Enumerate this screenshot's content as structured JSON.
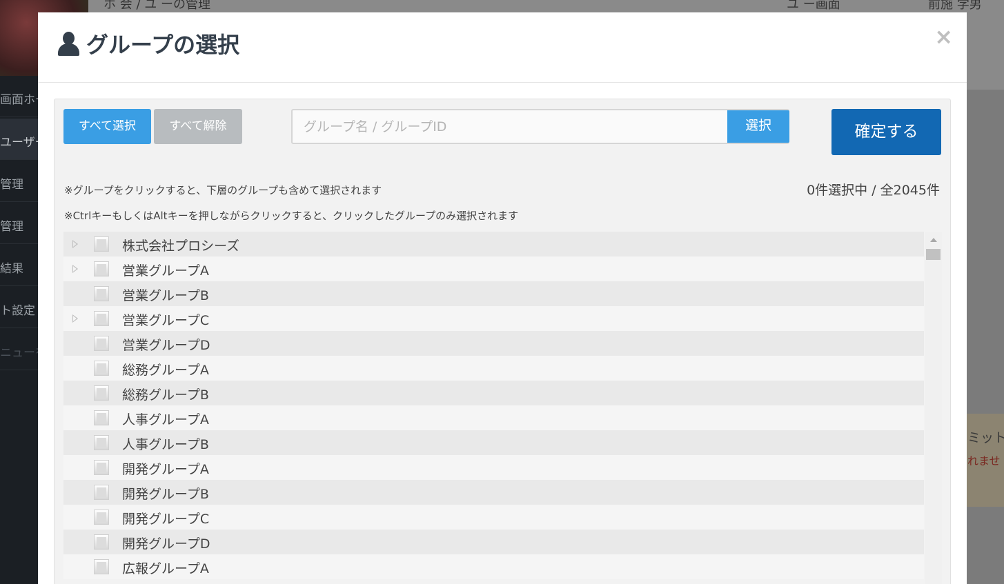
{
  "background": {
    "breadcrumb": "ホ  会 / ユ   ーの管理",
    "nav_items": [
      "ユ   ー画面",
      "前施 学男"
    ],
    "sidebar_items": [
      {
        "label": "画面ホーム",
        "state": "normal"
      },
      {
        "label": "ユーザー管理",
        "state": "active"
      },
      {
        "label": "管理",
        "state": "normal"
      },
      {
        "label": "管理",
        "state": "normal"
      },
      {
        "label": "結果",
        "state": "normal"
      },
      {
        "label": "ト設定",
        "state": "normal"
      },
      {
        "label": "ニューを",
        "state": "dim"
      }
    ],
    "alert": {
      "line1": "ミット",
      "line2": "れませ"
    }
  },
  "modal": {
    "title": "グループの選択",
    "title_icon": "user-icon",
    "close_label": "×",
    "buttons": {
      "select_all": "すべて選択",
      "clear_all": "すべて解除",
      "search": "選択",
      "confirm": "確定する"
    },
    "search": {
      "placeholder": "グループ名 / グループID",
      "value": ""
    },
    "notes": [
      "※グループをクリックすると、下層のグループも含めて選択されます",
      "※CtrlキーもしくはAltキーを押しながらクリックすると、クリックしたグループのみ選択されます"
    ],
    "count_text": "0件選択中 / 全2045件",
    "groups": [
      {
        "label": "株式会社プロシーズ",
        "expandable": true,
        "checked": false
      },
      {
        "label": "営業グループA",
        "expandable": true,
        "checked": false
      },
      {
        "label": "営業グループB",
        "expandable": false,
        "checked": false
      },
      {
        "label": "営業グループC",
        "expandable": true,
        "checked": false
      },
      {
        "label": "営業グループD",
        "expandable": false,
        "checked": false
      },
      {
        "label": "総務グループA",
        "expandable": false,
        "checked": false
      },
      {
        "label": "総務グループB",
        "expandable": false,
        "checked": false
      },
      {
        "label": "人事グループA",
        "expandable": false,
        "checked": false
      },
      {
        "label": "人事グループB",
        "expandable": false,
        "checked": false
      },
      {
        "label": "開発グループA",
        "expandable": false,
        "checked": false
      },
      {
        "label": "開発グループB",
        "expandable": false,
        "checked": false
      },
      {
        "label": "開発グループC",
        "expandable": false,
        "checked": false
      },
      {
        "label": "開発グループD",
        "expandable": false,
        "checked": false
      },
      {
        "label": "広報グループA",
        "expandable": false,
        "checked": false
      }
    ]
  },
  "colors": {
    "primary": "#3a9ee4",
    "confirm": "#1268b3",
    "muted_button": "#b8bcbf",
    "title": "#343f4b"
  }
}
